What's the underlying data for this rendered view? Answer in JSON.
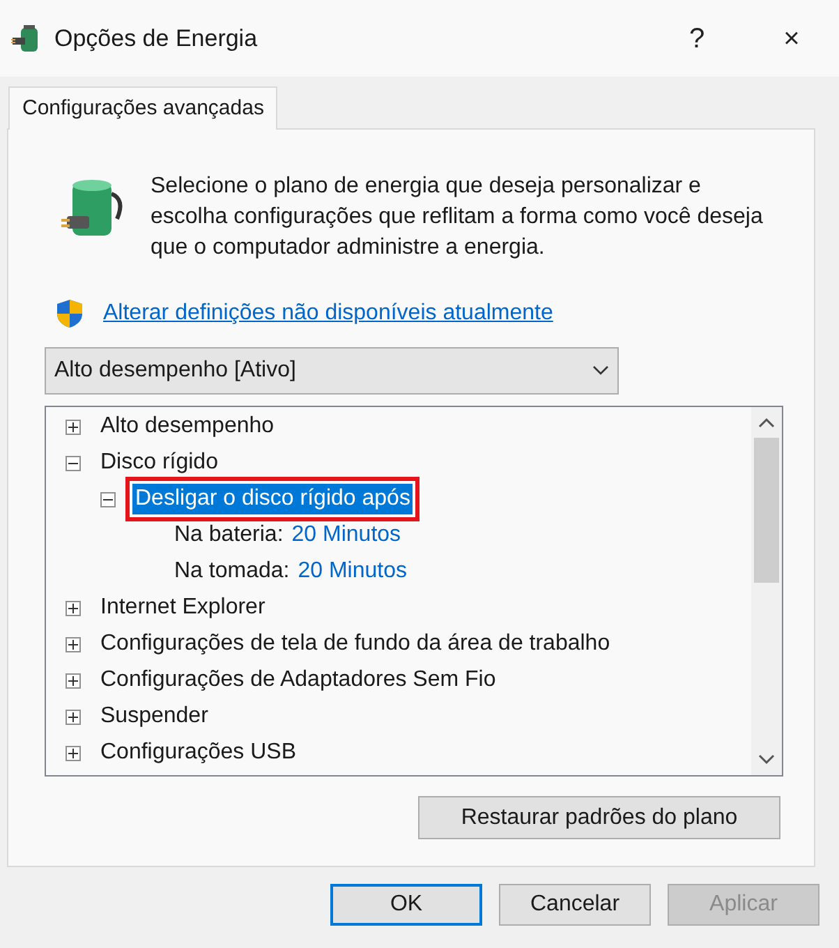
{
  "window": {
    "title": "Opções de Energia"
  },
  "title_buttons": [
    "?",
    "×"
  ],
  "tabs": [
    {
      "label": "Configurações avançadas",
      "selected": true
    }
  ],
  "description": "Selecione o plano de energia que deseja personalizar e escolha configurações que reflitam a forma como você deseja que o computador administre a energia.",
  "link": "Alterar definições não disponíveis atualmente",
  "plan_select": {
    "value": "Alto desempenho [Ativo]"
  },
  "tree": [
    {
      "label": "Alto desempenho",
      "expanded": false,
      "selected": false
    },
    {
      "label": "Disco rígido",
      "expanded": true,
      "selected": false,
      "children": [
        {
          "label": "Desligar o disco rígido após",
          "expanded": true,
          "selected": true,
          "highlighted": true,
          "settings": [
            {
              "label": "Na bateria:",
              "value": "20 Minutos"
            },
            {
              "label": "Na tomada:",
              "value": "20 Minutos"
            }
          ]
        }
      ]
    },
    {
      "label": "Internet Explorer",
      "expanded": false,
      "selected": false
    },
    {
      "label": "Configurações de tela de fundo da área de trabalho",
      "expanded": false,
      "selected": false
    },
    {
      "label": "Configurações de Adaptadores Sem Fio",
      "expanded": false,
      "selected": false
    },
    {
      "label": "Suspender",
      "expanded": false,
      "selected": false
    },
    {
      "label": "Configurações USB",
      "expanded": false,
      "selected": false
    }
  ],
  "restore_button": "Restaurar padrões do plano",
  "buttons": [
    {
      "label": "OK",
      "default": true,
      "disabled": false
    },
    {
      "label": "Cancelar",
      "default": false,
      "disabled": false
    },
    {
      "label": "Aplicar",
      "default": false,
      "disabled": true
    }
  ]
}
